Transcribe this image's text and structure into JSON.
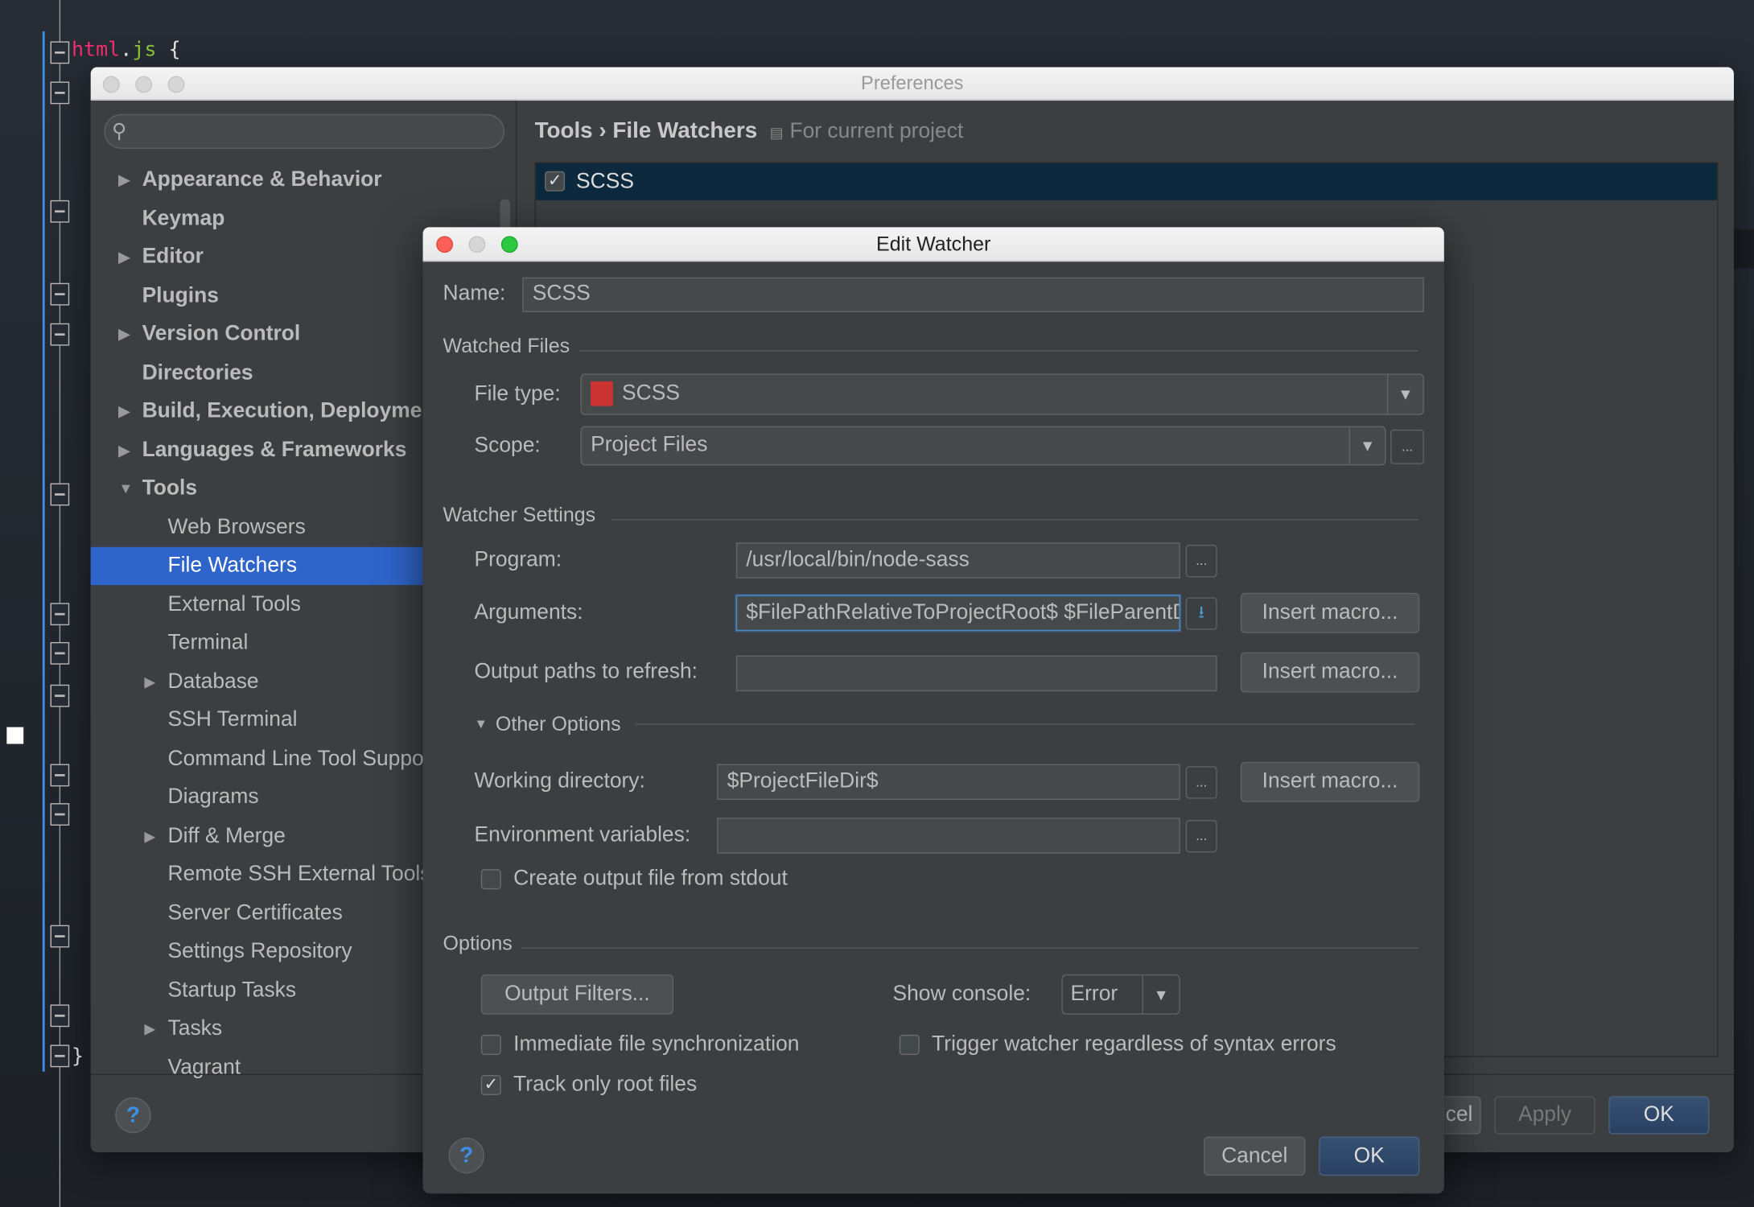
{
  "editor": {
    "code_selector": "html",
    "code_dot": ".",
    "code_class": "js",
    "code_brace": "{",
    "closing_brace": "}"
  },
  "preferences": {
    "title": "Preferences",
    "search_placeholder": "",
    "tree": [
      {
        "label": "Appearance & Behavior",
        "level": 0,
        "bold": true,
        "expandable": true
      },
      {
        "label": "Keymap",
        "level": 0,
        "bold": true
      },
      {
        "label": "Editor",
        "level": 0,
        "bold": true,
        "expandable": true
      },
      {
        "label": "Plugins",
        "level": 0,
        "bold": true
      },
      {
        "label": "Version Control",
        "level": 0,
        "bold": true,
        "expandable": true
      },
      {
        "label": "Directories",
        "level": 0,
        "bold": true
      },
      {
        "label": "Build, Execution, Deployment",
        "level": 0,
        "bold": true,
        "expandable": true
      },
      {
        "label": "Languages & Frameworks",
        "level": 0,
        "bold": true,
        "expandable": true
      },
      {
        "label": "Tools",
        "level": 0,
        "bold": true,
        "expanded": true
      },
      {
        "label": "Web Browsers",
        "level": 1
      },
      {
        "label": "File Watchers",
        "level": 1,
        "selected": true
      },
      {
        "label": "External Tools",
        "level": 1
      },
      {
        "label": "Terminal",
        "level": 1
      },
      {
        "label": "Database",
        "level": 1,
        "expandable": true
      },
      {
        "label": "SSH Terminal",
        "level": 1
      },
      {
        "label": "Command Line Tool Support",
        "level": 1
      },
      {
        "label": "Diagrams",
        "level": 1
      },
      {
        "label": "Diff & Merge",
        "level": 1,
        "expandable": true
      },
      {
        "label": "Remote SSH External Tools",
        "level": 1
      },
      {
        "label": "Server Certificates",
        "level": 1
      },
      {
        "label": "Settings Repository",
        "level": 1
      },
      {
        "label": "Startup Tasks",
        "level": 1
      },
      {
        "label": "Tasks",
        "level": 1,
        "expandable": true
      },
      {
        "label": "Vagrant",
        "level": 1
      }
    ],
    "breadcrumb": {
      "parent": "Tools",
      "separator": "›",
      "current": "File Watchers",
      "scope_note": "For current project"
    },
    "watchers": [
      {
        "label": "SCSS",
        "enabled": true,
        "selected": true
      }
    ],
    "buttons": {
      "cancel": "Cancel",
      "apply": "Apply",
      "ok": "OK"
    },
    "help": "?"
  },
  "dialog": {
    "title": "Edit Watcher",
    "name_label": "Name:",
    "name_value": "SCSS",
    "watched_files": "Watched Files",
    "file_type_label": "File type:",
    "file_type_value": "SCSS",
    "file_type_icon": "sass-file-icon",
    "scope_label": "Scope:",
    "scope_value": "Project Files",
    "watcher_settings": "Watcher Settings",
    "program_label": "Program:",
    "program_value": "/usr/local/bin/node-sass",
    "arguments_label": "Arguments:",
    "arguments_value": "$FilePathRelativeToProjectRoot$ $FileParentDir$",
    "output_paths_label": "Output paths to refresh:",
    "output_paths_value": "",
    "insert_macro": "Insert macro...",
    "other_options": "Other Options",
    "working_dir_label": "Working directory:",
    "working_dir_value": "$ProjectFileDir$",
    "env_label": "Environment variables:",
    "env_value": "",
    "create_output": {
      "label": "Create output file from stdout",
      "checked": false
    },
    "options": "Options",
    "output_filters": "Output Filters...",
    "show_console_label": "Show console:",
    "show_console_value": "Error",
    "immediate_sync": {
      "label": "Immediate file synchronization",
      "checked": false
    },
    "trigger_regardless": {
      "label": "Trigger watcher regardless of syntax errors",
      "checked": false
    },
    "track_root": {
      "label": "Track only root files",
      "checked": true
    },
    "dots": "...",
    "cancel": "Cancel",
    "ok": "OK",
    "help": "?"
  }
}
